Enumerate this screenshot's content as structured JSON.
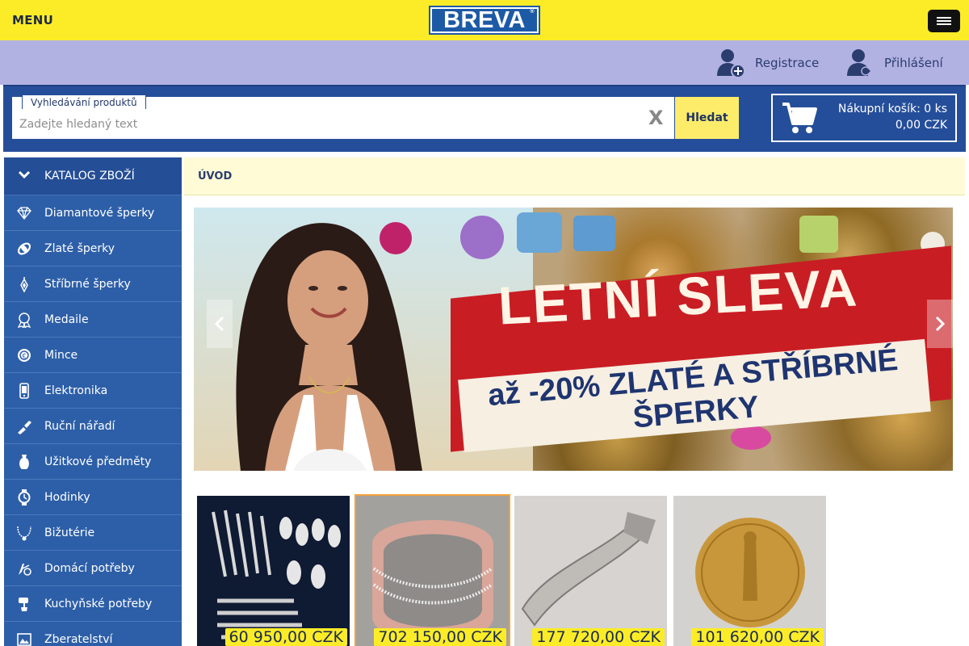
{
  "header": {
    "menu_label": "MENU",
    "logo_text": "BREVA",
    "logo_mark": "®"
  },
  "account": {
    "register_label": "Registrace",
    "login_label": "Přihlášení"
  },
  "search": {
    "legend": "Vyhledávání produktů",
    "placeholder": "Zadejte hledaný text",
    "value": "",
    "clear_label": "X",
    "button_label": "Hledat"
  },
  "cart": {
    "line1": "Nákupní košík: 0 ks",
    "line2": "0,00 CZK"
  },
  "sidebar": {
    "header_label": "KATALOG ZBOŽÍ",
    "items": [
      {
        "label": "Diamantové šperky",
        "icon": "diamond-icon"
      },
      {
        "label": "Zlaté šperky",
        "icon": "gold-ring-icon"
      },
      {
        "label": "Stříbrné šperky",
        "icon": "silver-jewel-icon"
      },
      {
        "label": "Medaile",
        "icon": "medal-icon"
      },
      {
        "label": "Mince",
        "icon": "coin-icon"
      },
      {
        "label": "Elektronika",
        "icon": "phone-icon"
      },
      {
        "label": "Ruční nářadí",
        "icon": "tool-icon"
      },
      {
        "label": "Užitkové předměty",
        "icon": "vase-icon"
      },
      {
        "label": "Hodinky",
        "icon": "watch-icon"
      },
      {
        "label": "Bižutérie",
        "icon": "necklace-icon"
      },
      {
        "label": "Domácí potřeby",
        "icon": "household-icon"
      },
      {
        "label": "Kuchyňské potřeby",
        "icon": "mixer-icon"
      },
      {
        "label": "Zberatelství",
        "icon": "collector-icon"
      }
    ]
  },
  "breadcrumb": {
    "label": "ÚVOD"
  },
  "banner": {
    "title": "LETNÍ SLEVA",
    "subtitle": "až -20% ZLATÉ A STŘÍBRNÉ ŠPERKY",
    "accent_red": "#c91d24",
    "accent_blue": "#1f3570"
  },
  "products": [
    {
      "price": "60 950,00 CZK",
      "kind": "silver-cutlery"
    },
    {
      "price": "702 150,00 CZK",
      "kind": "bracelet"
    },
    {
      "price": "177 720,00 CZK",
      "kind": "silver-bracelet"
    },
    {
      "price": "101 620,00 CZK",
      "kind": "gold-coin"
    }
  ],
  "colors": {
    "header_yellow": "#fcec27",
    "account_lavender": "#b2b2e2",
    "brand_blue": "#254e9a",
    "sidebar_blue": "#2d5fa8",
    "price_yellow": "#fcec27"
  }
}
